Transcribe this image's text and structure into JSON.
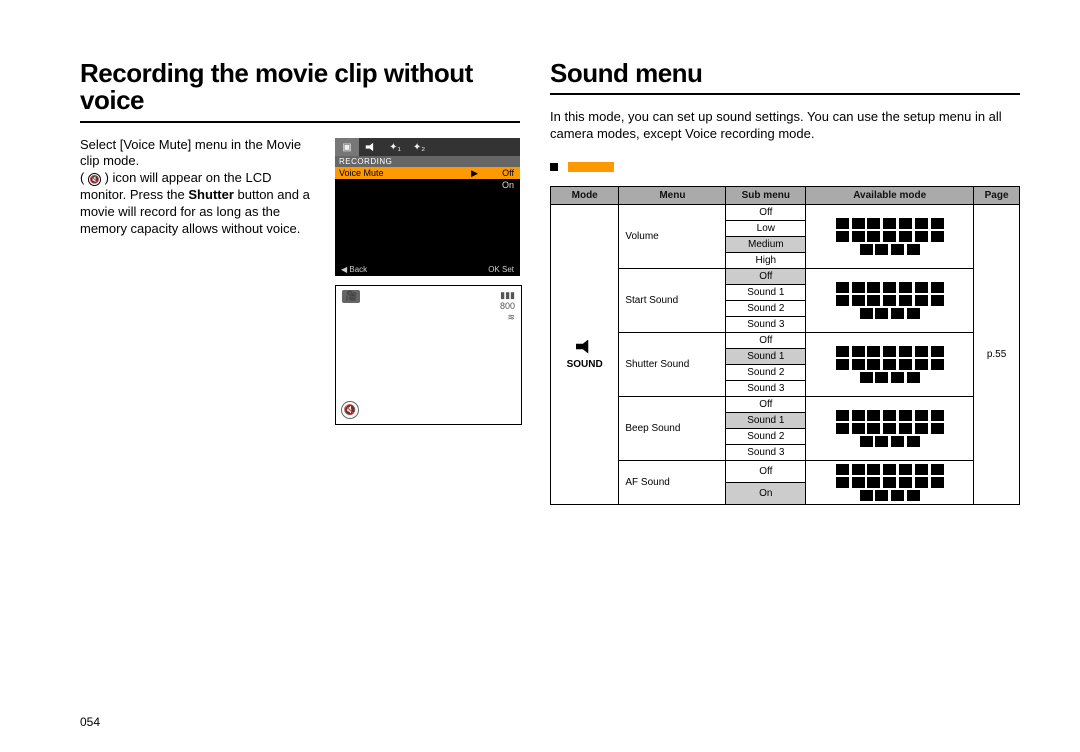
{
  "left": {
    "title": "Recording the movie clip without voice",
    "body1": "Select [Voice Mute] menu in the Movie clip mode.",
    "body2_prefix": "(",
    "body2_iconname": "mute-icon",
    "body2_mid": " ) icon will appear on the LCD monitor. Press the ",
    "body2_button": "Shutter",
    "body2_end": " button and a movie will record for as long as the memory capacity allows without voice.",
    "lcd1": {
      "section": "RECORDING",
      "item": "Voice Mute",
      "options": [
        "Off",
        "On"
      ],
      "back": "Back",
      "ok": "OK",
      "set": "Set"
    },
    "lcd2": {
      "stby": "800"
    }
  },
  "right": {
    "title": "Sound menu",
    "intro": "In this mode, you can set up sound settings. You can use the setup menu in all camera modes, except Voice recording mode.",
    "tbl_headers": [
      "Mode",
      "Menu",
      "Sub menu",
      "Available mode",
      "Page"
    ],
    "sound_label": "SOUND",
    "page_ref": "p.55",
    "groups": [
      {
        "menu": "Volume",
        "subs": [
          "Off",
          "Low",
          "Medium",
          "High"
        ],
        "default_index": 2
      },
      {
        "menu": "Start Sound",
        "subs": [
          "Off",
          "Sound 1",
          "Sound 2",
          "Sound 3"
        ],
        "default_index": 0
      },
      {
        "menu": "Shutter Sound",
        "subs": [
          "Off",
          "Sound 1",
          "Sound 2",
          "Sound 3"
        ],
        "default_index": 1
      },
      {
        "menu": "Beep Sound",
        "subs": [
          "Off",
          "Sound 1",
          "Sound 2",
          "Sound 3"
        ],
        "default_index": 1
      },
      {
        "menu": "AF Sound",
        "subs": [
          "Off",
          "On"
        ],
        "default_index": 1
      }
    ]
  },
  "page_number": "054"
}
